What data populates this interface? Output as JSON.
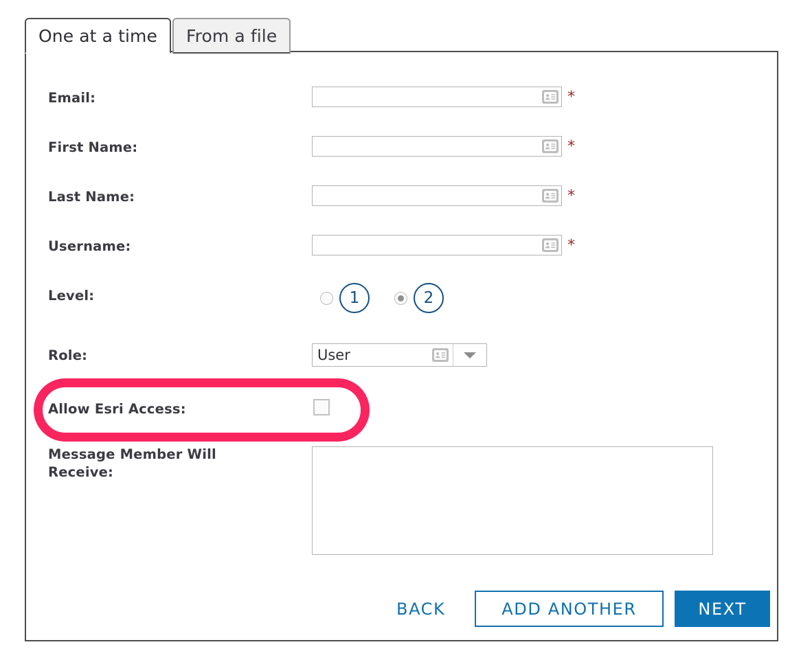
{
  "tabs": [
    {
      "label": "One at a time",
      "active": true
    },
    {
      "label": "From a file",
      "active": false
    }
  ],
  "form": {
    "required_marker": "*",
    "fields": [
      {
        "label": "Email:",
        "value": "",
        "placeholder": "",
        "icon": "contact-card-icon",
        "required": true
      },
      {
        "label": "First Name:",
        "value": "",
        "placeholder": "",
        "icon": "contact-card-icon",
        "required": true
      },
      {
        "label": "Last Name:",
        "value": "",
        "placeholder": "",
        "icon": "contact-card-icon",
        "required": true
      },
      {
        "label": "Username:",
        "value": "",
        "placeholder": "",
        "icon": "contact-card-icon",
        "required": true
      }
    ],
    "level": {
      "label": "Level:",
      "options": [
        {
          "label": "1",
          "selected": false
        },
        {
          "label": "2",
          "selected": true
        }
      ]
    },
    "role": {
      "label": "Role:",
      "value": "User",
      "icon": "contact-card-icon",
      "dropdown_icon": "chevron-down-icon"
    },
    "esri_access": {
      "label": "Allow Esri Access:",
      "checked": false,
      "highlighted": true
    },
    "message": {
      "label": "Message Member Will Receive:",
      "value": "",
      "placeholder": ""
    }
  },
  "actions": {
    "back": "BACK",
    "add_another": "ADD ANOTHER",
    "next": "NEXT"
  },
  "colors": {
    "highlight": "#fa255f",
    "primary_blue": "#0c74b5",
    "link_blue": "#1071ad",
    "level_circle": "#13507e",
    "required_red": "#9e2a2b",
    "label_text": "#3b3b42",
    "panel_border": "#4d4d4d"
  }
}
